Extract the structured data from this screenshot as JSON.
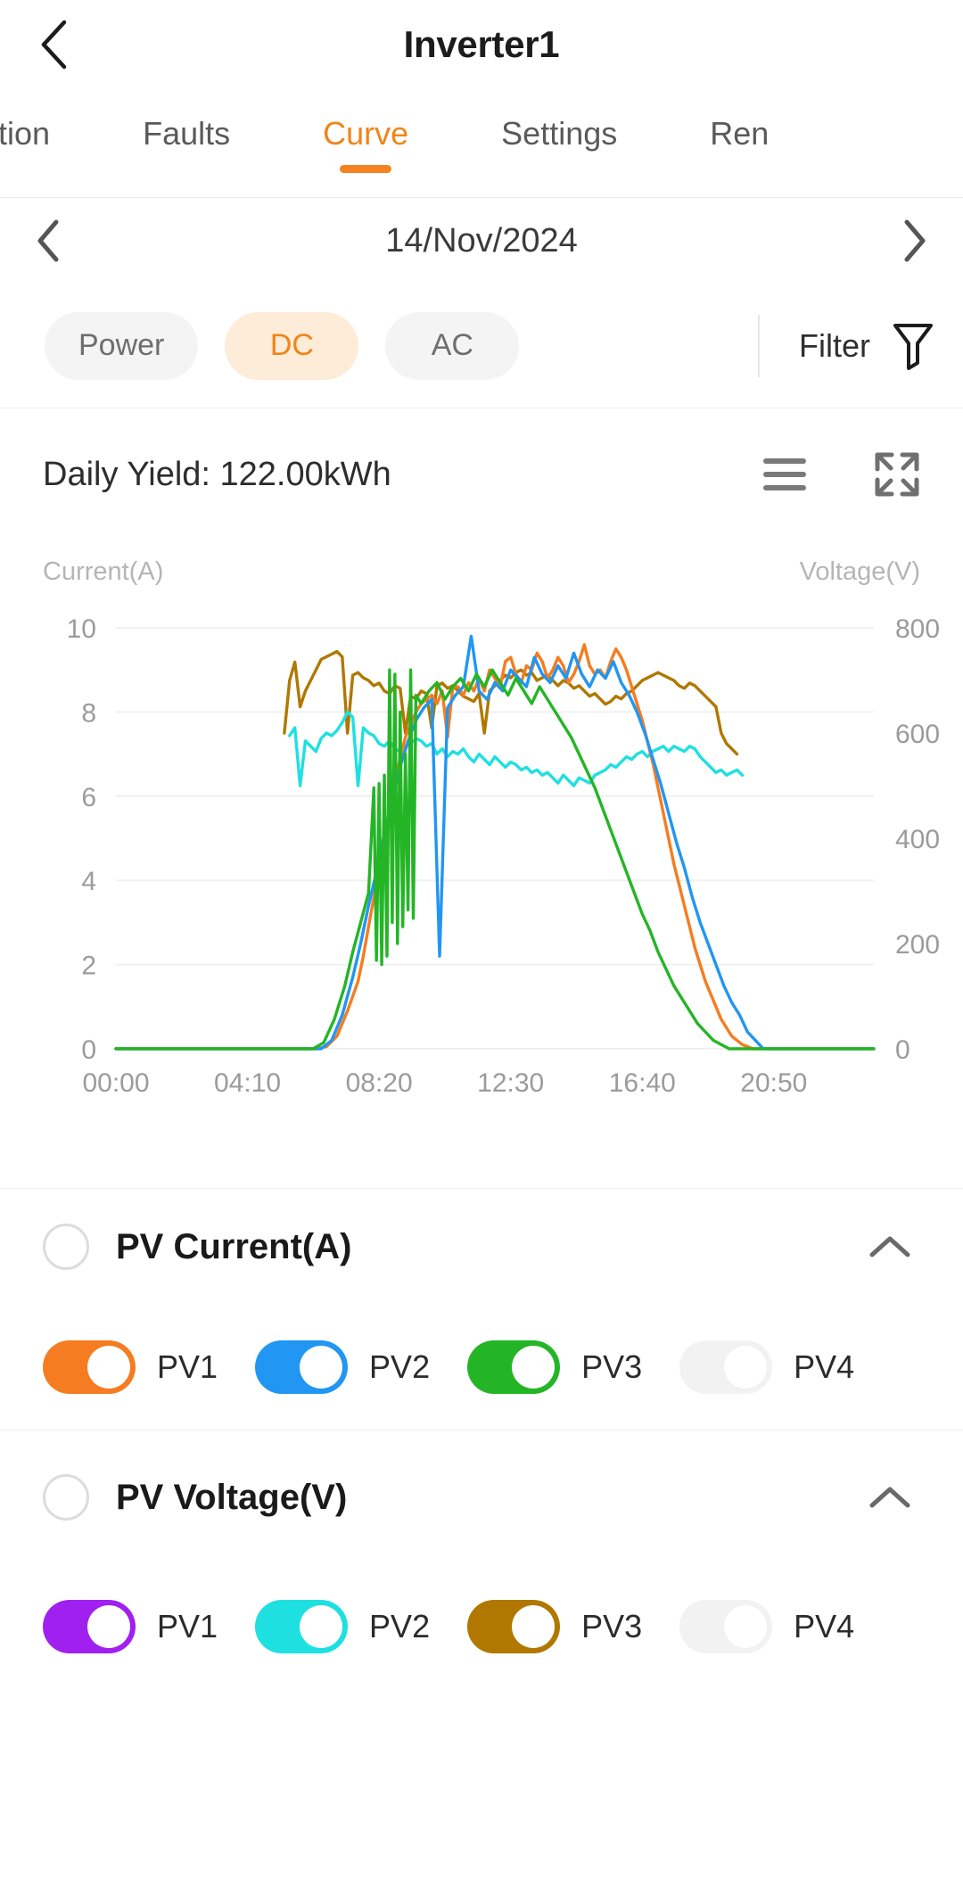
{
  "header": {
    "title": "Inverter1",
    "back_icon": "chevron-left-icon"
  },
  "tabs": [
    {
      "label": "ation",
      "active": false
    },
    {
      "label": "Faults",
      "active": false
    },
    {
      "label": "Curve",
      "active": true
    },
    {
      "label": "Settings",
      "active": false
    },
    {
      "label": "Ren",
      "active": false
    }
  ],
  "date_nav": {
    "prev_icon": "chevron-left-icon",
    "next_icon": "chevron-right-icon",
    "date": "14/Nov/2024"
  },
  "filter_bar": {
    "chips": [
      {
        "label": "Power",
        "selected": false
      },
      {
        "label": "DC",
        "selected": true
      },
      {
        "label": "AC",
        "selected": false
      }
    ],
    "filter_label": "Filter",
    "filter_icon": "funnel-icon"
  },
  "card": {
    "yield_label": "Daily Yield: 122.00kWh",
    "list_icon": "hamburger-list-icon",
    "fullscreen_icon": "expand-fullscreen-icon"
  },
  "chart_data": {
    "type": "line",
    "title": "Daily Yield: 122.00kWh",
    "left_axis_label": "Current(A)",
    "right_axis_label": "Voltage(V)",
    "xlabel": "",
    "grid": true,
    "legend_position": "below-chart",
    "x_ticks": [
      "00:00",
      "04:10",
      "08:20",
      "12:30",
      "16:40",
      "20:50"
    ],
    "x_tick_minutes": [
      0,
      250,
      500,
      750,
      1000,
      1250
    ],
    "xlim_minutes": [
      0,
      1440
    ],
    "left_ticks": [
      0,
      2,
      4,
      6,
      8,
      10
    ],
    "ylim_left": [
      0,
      10
    ],
    "right_ticks": [
      0,
      200,
      400,
      600,
      800
    ],
    "ylim_right": [
      0,
      800
    ],
    "series": [
      {
        "name": "PV1 Current(A)",
        "axis": "left",
        "unit": "A",
        "color": "#f57c20",
        "enabled": true,
        "x": [
          0,
          380,
          400,
          420,
          440,
          460,
          470,
          480,
          490,
          500,
          510,
          520,
          530,
          540,
          550,
          560,
          570,
          580,
          590,
          600,
          610,
          620,
          630,
          640,
          650,
          660,
          670,
          680,
          690,
          700,
          710,
          720,
          730,
          740,
          750,
          760,
          770,
          780,
          790,
          800,
          810,
          820,
          830,
          840,
          850,
          860,
          870,
          880,
          890,
          900,
          910,
          920,
          930,
          940,
          950,
          960,
          970,
          980,
          990,
          1000,
          1010,
          1020,
          1030,
          1040,
          1050,
          1060,
          1070,
          1080,
          1090,
          1100,
          1110,
          1120,
          1130,
          1140,
          1150,
          1160,
          1170,
          1180,
          1190,
          1200,
          1210,
          1220,
          1230,
          1240,
          1440
        ],
        "y": [
          0,
          0,
          0.05,
          0.3,
          0.9,
          1.6,
          2.2,
          2.9,
          3.6,
          4.3,
          5.0,
          5.6,
          6.3,
          6.9,
          7.4,
          7.7,
          8.0,
          8.2,
          8.3,
          8.4,
          8.2,
          8.5,
          7.4,
          8.6,
          8.6,
          8.4,
          8.7,
          8.5,
          8.8,
          8.5,
          9.0,
          8.8,
          8.6,
          9.2,
          9.3,
          8.9,
          8.7,
          9.1,
          9.0,
          9.4,
          9.2,
          8.8,
          9.0,
          9.3,
          9.1,
          8.7,
          8.9,
          9.2,
          9.6,
          9.1,
          8.9,
          9.0,
          8.8,
          9.2,
          9.5,
          9.3,
          9.0,
          8.6,
          8.2,
          7.8,
          7.3,
          6.8,
          6.2,
          5.6,
          5.0,
          4.4,
          3.9,
          3.4,
          2.9,
          2.4,
          2.0,
          1.6,
          1.3,
          1.0,
          0.7,
          0.5,
          0.3,
          0.2,
          0.1,
          0.05,
          0,
          0,
          0,
          0,
          0
        ]
      },
      {
        "name": "PV2 Current(A)",
        "axis": "left",
        "unit": "A",
        "color": "#2196f3",
        "enabled": true,
        "x": [
          0,
          390,
          410,
          430,
          450,
          465,
          480,
          495,
          510,
          525,
          540,
          555,
          570,
          585,
          600,
          615,
          630,
          645,
          660,
          675,
          690,
          705,
          720,
          735,
          750,
          765,
          780,
          795,
          810,
          825,
          840,
          855,
          870,
          885,
          900,
          915,
          930,
          945,
          960,
          975,
          990,
          1005,
          1020,
          1035,
          1050,
          1065,
          1080,
          1095,
          1110,
          1125,
          1140,
          1155,
          1170,
          1185,
          1200,
          1215,
          1230,
          1440
        ],
        "y": [
          0,
          0,
          0.2,
          0.8,
          1.7,
          2.5,
          3.4,
          4.2,
          5.1,
          5.9,
          6.7,
          7.3,
          7.8,
          8.1,
          8.3,
          2.2,
          8.1,
          8.4,
          8.6,
          9.8,
          8.5,
          8.3,
          8.7,
          8.5,
          9.0,
          8.8,
          8.6,
          9.3,
          8.9,
          8.7,
          9.1,
          8.8,
          9.4,
          8.9,
          8.6,
          9.0,
          8.8,
          9.2,
          8.7,
          8.4,
          8.0,
          7.5,
          6.9,
          6.3,
          5.6,
          4.9,
          4.3,
          3.6,
          3.0,
          2.5,
          2.0,
          1.5,
          1.1,
          0.8,
          0.4,
          0.2,
          0,
          0
        ]
      },
      {
        "name": "PV3 Current(A)",
        "axis": "left",
        "unit": "A",
        "color": "#24b526",
        "enabled": true,
        "x": [
          0,
          375,
          395,
          415,
          435,
          450,
          465,
          480,
          490,
          495,
          500,
          505,
          510,
          515,
          520,
          525,
          530,
          535,
          540,
          545,
          550,
          555,
          560,
          565,
          570,
          580,
          595,
          610,
          625,
          640,
          655,
          670,
          685,
          700,
          715,
          730,
          745,
          760,
          775,
          790,
          805,
          820,
          835,
          850,
          865,
          880,
          895,
          910,
          925,
          940,
          955,
          970,
          985,
          1000,
          1015,
          1030,
          1045,
          1060,
          1075,
          1090,
          1105,
          1120,
          1135,
          1150,
          1165,
          1180,
          1195,
          1210,
          1225,
          1240,
          1440
        ],
        "y": [
          0,
          0,
          0.15,
          0.7,
          1.5,
          2.3,
          3.0,
          3.7,
          6.2,
          2.1,
          6.3,
          2.0,
          6.5,
          2.2,
          9.0,
          3.0,
          8.9,
          2.5,
          8.0,
          2.9,
          7.0,
          3.3,
          9.0,
          3.1,
          8.4,
          8.2,
          8.5,
          8.7,
          8.3,
          8.6,
          8.8,
          8.5,
          8.9,
          8.6,
          9.0,
          8.7,
          8.4,
          8.8,
          8.5,
          8.2,
          8.6,
          8.3,
          8.0,
          7.7,
          7.4,
          7.0,
          6.6,
          6.2,
          5.7,
          5.2,
          4.7,
          4.2,
          3.7,
          3.2,
          2.8,
          2.3,
          1.9,
          1.5,
          1.2,
          0.9,
          0.6,
          0.4,
          0.2,
          0.1,
          0,
          0,
          0,
          0,
          0,
          0,
          0
        ]
      },
      {
        "name": "PV4 Current(A)",
        "axis": "left",
        "unit": "A",
        "color": "#e8e8e8",
        "enabled": false,
        "x": [],
        "y": []
      },
      {
        "name": "PV1 Voltage(V)",
        "axis": "right",
        "unit": "V",
        "color": "#a020f0",
        "enabled": true,
        "x": [],
        "y": []
      },
      {
        "name": "PV2 Voltage(V)",
        "axis": "right",
        "unit": "V",
        "color": "#1fe0e0",
        "enabled": true,
        "x": [
          0,
          320,
          330,
          340,
          350,
          360,
          370,
          380,
          390,
          400,
          410,
          420,
          430,
          440,
          450,
          460,
          470,
          480,
          490,
          500,
          510,
          520,
          530,
          540,
          550,
          560,
          570,
          580,
          590,
          600,
          610,
          620,
          630,
          640,
          650,
          660,
          670,
          680,
          690,
          700,
          710,
          720,
          730,
          740,
          750,
          760,
          770,
          780,
          790,
          800,
          810,
          820,
          830,
          840,
          850,
          860,
          870,
          880,
          890,
          900,
          910,
          920,
          930,
          940,
          950,
          960,
          970,
          980,
          990,
          1000,
          1010,
          1020,
          1030,
          1040,
          1050,
          1060,
          1070,
          1080,
          1090,
          1100,
          1110,
          1120,
          1130,
          1140,
          1150,
          1160,
          1170,
          1180,
          1190,
          1200
        ],
        "y": [
          null,
          null,
          595,
          610,
          500,
          585,
          575,
          565,
          590,
          600,
          595,
          605,
          620,
          640,
          630,
          500,
          610,
          600,
          595,
          580,
          575,
          585,
          570,
          565,
          575,
          580,
          590,
          585,
          575,
          580,
          560,
          570,
          555,
          565,
          560,
          570,
          555,
          545,
          560,
          550,
          540,
          555,
          545,
          535,
          545,
          540,
          530,
          535,
          525,
          530,
          520,
          525,
          515,
          505,
          520,
          510,
          500,
          515,
          510,
          505,
          520,
          525,
          530,
          540,
          535,
          545,
          555,
          550,
          560,
          565,
          555,
          565,
          570,
          575,
          565,
          575,
          570,
          565,
          575,
          570,
          555,
          545,
          535,
          525,
          530,
          520,
          525,
          530,
          520
        ]
      },
      {
        "name": "PV3 Voltage(V)",
        "axis": "right",
        "unit": "V",
        "color": "#b07800",
        "enabled": true,
        "x": [
          0,
          310,
          320,
          330,
          340,
          350,
          360,
          370,
          380,
          390,
          400,
          410,
          420,
          430,
          440,
          450,
          460,
          470,
          480,
          490,
          500,
          510,
          520,
          530,
          540,
          550,
          560,
          570,
          580,
          590,
          600,
          610,
          620,
          630,
          640,
          650,
          660,
          670,
          680,
          690,
          700,
          710,
          720,
          730,
          740,
          750,
          760,
          770,
          780,
          790,
          800,
          810,
          820,
          830,
          840,
          850,
          860,
          870,
          880,
          890,
          900,
          910,
          920,
          930,
          940,
          950,
          960,
          970,
          980,
          990,
          1000,
          1010,
          1020,
          1030,
          1040,
          1050,
          1060,
          1070,
          1080,
          1090,
          1100,
          1110,
          1120,
          1130,
          1140,
          1150,
          1160,
          1170,
          1180,
          1190,
          1200
        ],
        "y": [
          null,
          null,
          600,
          700,
          735,
          650,
          680,
          700,
          720,
          740,
          745,
          750,
          755,
          745,
          600,
          710,
          715,
          705,
          700,
          690,
          695,
          680,
          675,
          690,
          685,
          600,
          670,
          665,
          680,
          675,
          610,
          690,
          695,
          685,
          690,
          680,
          670,
          665,
          660,
          675,
          600,
          680,
          690,
          700,
          710,
          705,
          715,
          720,
          710,
          715,
          700,
          705,
          710,
          700,
          690,
          700,
          695,
          685,
          690,
          680,
          670,
          675,
          665,
          655,
          660,
          670,
          665,
          675,
          680,
          690,
          700,
          705,
          710,
          715,
          710,
          705,
          700,
          690,
          685,
          695,
          690,
          680,
          670,
          660,
          650,
          600,
          580,
          570,
          560
        ]
      },
      {
        "name": "PV4 Voltage(V)",
        "axis": "right",
        "unit": "V",
        "color": "#e8e8e8",
        "enabled": false,
        "x": [],
        "y": []
      }
    ]
  },
  "sections": [
    {
      "title": "PV Current(A)",
      "radio_selected": false,
      "collapse_icon": "chevron-up-icon",
      "items": [
        {
          "label": "PV1",
          "color": "#f57c20",
          "on": true
        },
        {
          "label": "PV2",
          "color": "#2196f3",
          "on": true
        },
        {
          "label": "PV3",
          "color": "#24b526",
          "on": true
        },
        {
          "label": "PV4",
          "color": "#f2f2f2",
          "on": false
        }
      ]
    },
    {
      "title": "PV Voltage(V)",
      "radio_selected": false,
      "collapse_icon": "chevron-up-icon",
      "items": [
        {
          "label": "PV1",
          "color": "#a020f0",
          "on": true
        },
        {
          "label": "PV2",
          "color": "#1fe0e0",
          "on": true
        },
        {
          "label": "PV3",
          "color": "#b07800",
          "on": true
        },
        {
          "label": "PV4",
          "color": "#f2f2f2",
          "on": false
        }
      ]
    }
  ],
  "colors": {
    "accent": "#f58220",
    "accent_soft": "#fdecd8",
    "text_primary": "#1c1c1c",
    "text_secondary": "#5a5a5a",
    "axis_text": "#9b9b9b",
    "grid": "#f0f0f0"
  }
}
